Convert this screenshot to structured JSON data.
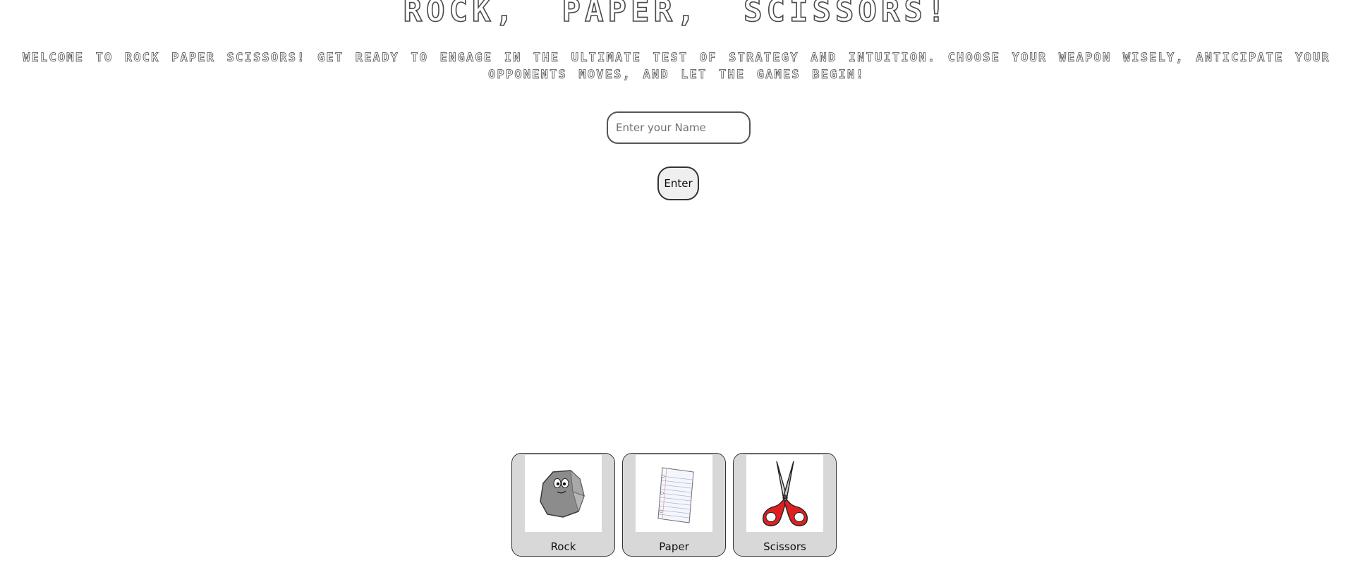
{
  "header": {
    "title": "Rock, Paper, Scissors!",
    "welcome_text": "Welcome to Rock Paper Scissors! Get ready to engage in the ultimate test of strategy and intuition. Choose your weapon wisely, anticipate your opponents moves, and let the games begin!"
  },
  "name_form": {
    "input_value": "",
    "input_placeholder": "Enter your Name",
    "submit_label": "Enter"
  },
  "choices": [
    {
      "label": "Rock",
      "icon": "rock-icon"
    },
    {
      "label": "Paper",
      "icon": "paper-icon"
    },
    {
      "label": "Scissors",
      "icon": "scissors-icon"
    }
  ],
  "colors": {
    "choice_background": "#d8d8d8",
    "scissors_handle": "#e02020",
    "rock": "#8c8c8c"
  }
}
